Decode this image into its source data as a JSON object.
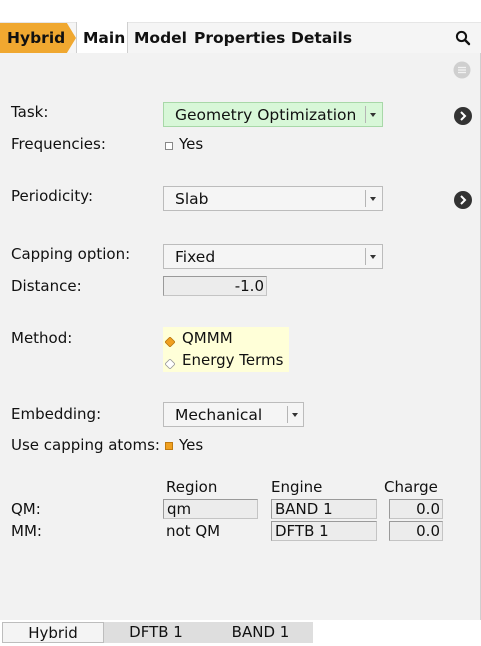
{
  "tabs": [
    "Hybrid",
    "Main",
    "Model",
    "Properties",
    "Details"
  ],
  "form": {
    "task_label": "Task:",
    "task_value": "Geometry Optimization",
    "frequencies_label": "Frequencies:",
    "frequencies_value": "Yes",
    "frequencies_checked": false,
    "periodicity_label": "Periodicity:",
    "periodicity_value": "Slab",
    "capping_label": "Capping option:",
    "capping_value": "Fixed",
    "distance_label": "Distance:",
    "distance_value": "-1.0",
    "method_label": "Method:",
    "method_options": [
      "QMMM",
      "Energy Terms"
    ],
    "method_selected": "QMMM",
    "embedding_label": "Embedding:",
    "embedding_value": "Mechanical",
    "use_capping_label": "Use capping atoms:",
    "use_capping_value": "Yes",
    "use_capping_checked": true
  },
  "regions": {
    "headers": [
      "Region",
      "Engine",
      "Charge"
    ],
    "rows": [
      {
        "label": "QM:",
        "region": "qm",
        "engine": "BAND 1",
        "charge": "0.0"
      },
      {
        "label": "MM:",
        "region": "not QM",
        "engine": "DFTB 1",
        "charge": "0.0"
      }
    ]
  },
  "bottom_tabs": [
    "Hybrid",
    "DFTB 1",
    "BAND 1"
  ],
  "colors": {
    "accent": "#f0a830",
    "task_highlight": "#d8f7d8",
    "method_highlight": "#ffffd8",
    "panel_bg": "#f2f2f2"
  },
  "icons": [
    "search-icon",
    "menu-icon",
    "chevron-right-icon"
  ]
}
